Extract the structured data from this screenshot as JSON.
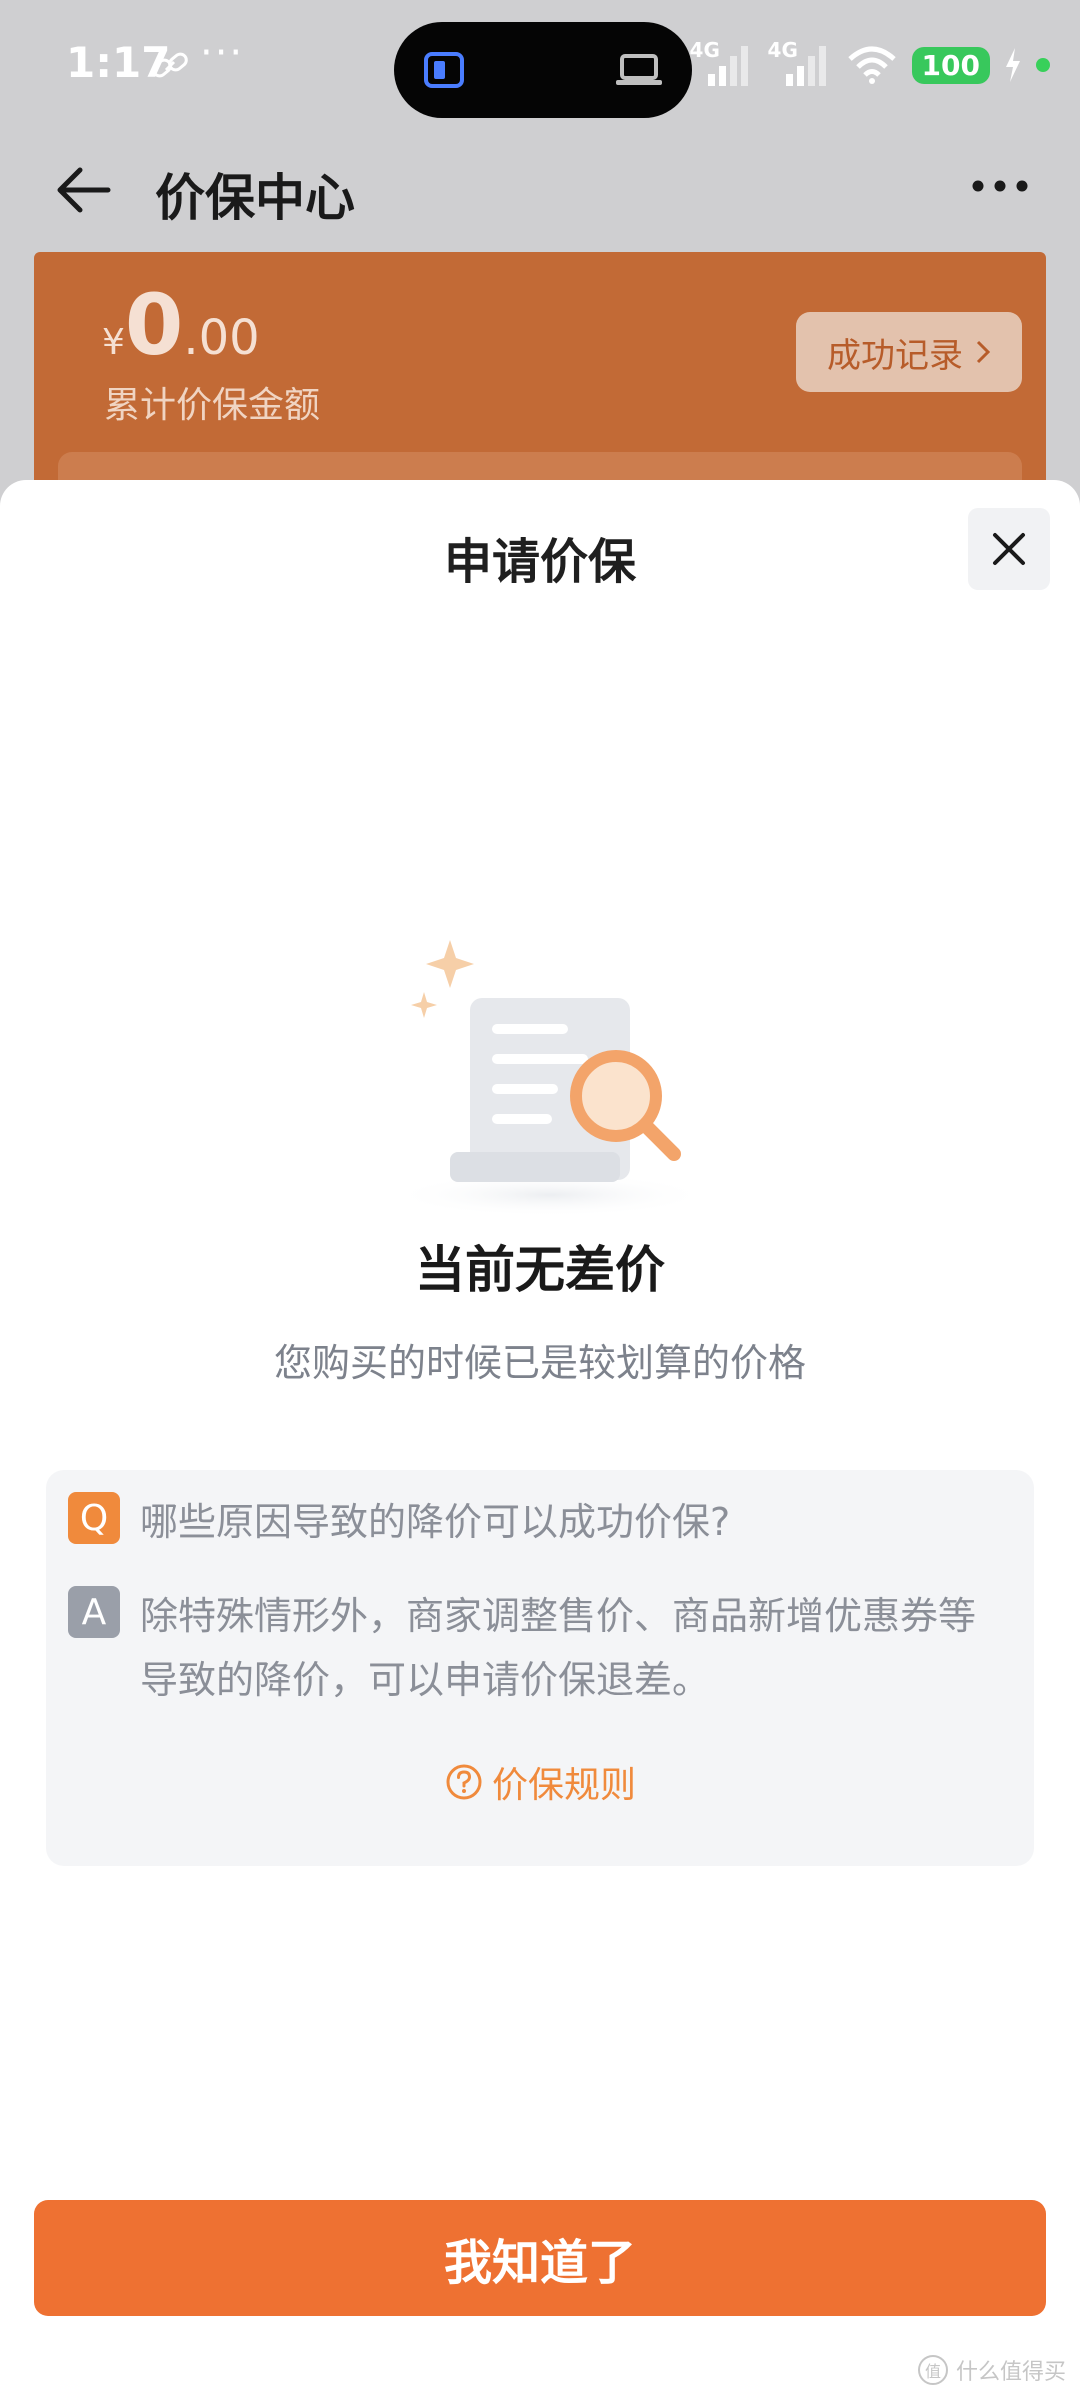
{
  "status_bar": {
    "time": "1:17",
    "more": "···",
    "network1": "4G",
    "network2": "4G",
    "battery": "100"
  },
  "header": {
    "title": "价保中心"
  },
  "summary": {
    "currency": "¥",
    "amount_int": "0",
    "amount_dec": ".00",
    "amount_label": "累计价保金额",
    "record_button": "成功记录"
  },
  "sheet": {
    "title": "申请价保",
    "empty_title": "当前无差价",
    "empty_desc": "您购买的时候已是较划算的价格",
    "faq": {
      "q_badge": "Q",
      "question": "哪些原因导致的降价可以成功价保?",
      "a_badge": "A",
      "answer": "除特殊情形外，商家调整售价、商品新增优惠券等导致的降价，可以申请价保退差。",
      "rules_link": "价保规则"
    },
    "confirm_button": "我知道了"
  },
  "watermark": {
    "text": "什么值得买"
  },
  "colors": {
    "accent": "#ee7132",
    "summary_bg": "#c26a36",
    "badge_q": "#f08a3c",
    "badge_a": "#9a9fa9"
  }
}
